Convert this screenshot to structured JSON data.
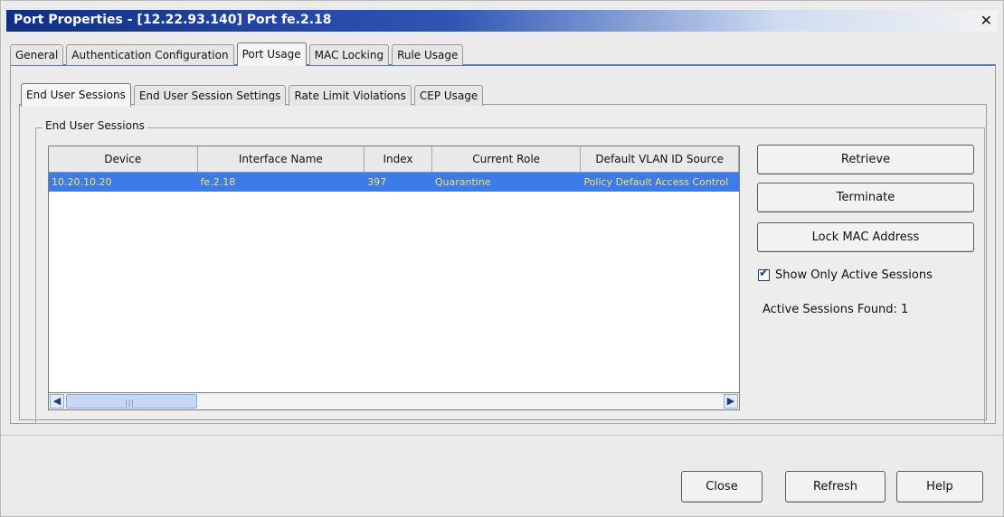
{
  "window": {
    "title": "Port Properties - [12.22.93.140] Port fe.2.18",
    "close_glyph": "✕"
  },
  "main_tabs": [
    {
      "label": "General",
      "active": false
    },
    {
      "label": "Authentication Configuration",
      "active": false
    },
    {
      "label": "Port Usage",
      "active": true
    },
    {
      "label": "MAC Locking",
      "active": false
    },
    {
      "label": "Rule Usage",
      "active": false
    }
  ],
  "sub_tabs": [
    {
      "label": "End User Sessions",
      "active": true
    },
    {
      "label": "End User Session Settings",
      "active": false
    },
    {
      "label": "Rate Limit Violations",
      "active": false
    },
    {
      "label": "CEP Usage",
      "active": false
    }
  ],
  "group": {
    "label": "End User Sessions"
  },
  "table": {
    "columns": [
      "Device",
      "Interface Name",
      "Index",
      "Current Role",
      "Default VLAN ID Source"
    ],
    "rows": [
      {
        "selected": true,
        "cells": [
          "10.20.10.20",
          "fe.2.18",
          "397",
          "Quarantine",
          "Policy Default Access Control"
        ]
      }
    ],
    "scroll_left_glyph": "◀",
    "scroll_right_glyph": "▶"
  },
  "actions": {
    "retrieve": "Retrieve",
    "terminate": "Terminate",
    "lock_mac": "Lock MAC Address",
    "show_active_label": "Show Only Active Sessions",
    "show_active_checked": true,
    "active_found": "Active Sessions Found:  1"
  },
  "footer": {
    "close": "Close",
    "refresh": "Refresh",
    "help": "Help"
  },
  "colors": {
    "title_gradient_start": "#0f2f86",
    "selection": "#3d7be8",
    "selection_text": "#f7e25a"
  }
}
